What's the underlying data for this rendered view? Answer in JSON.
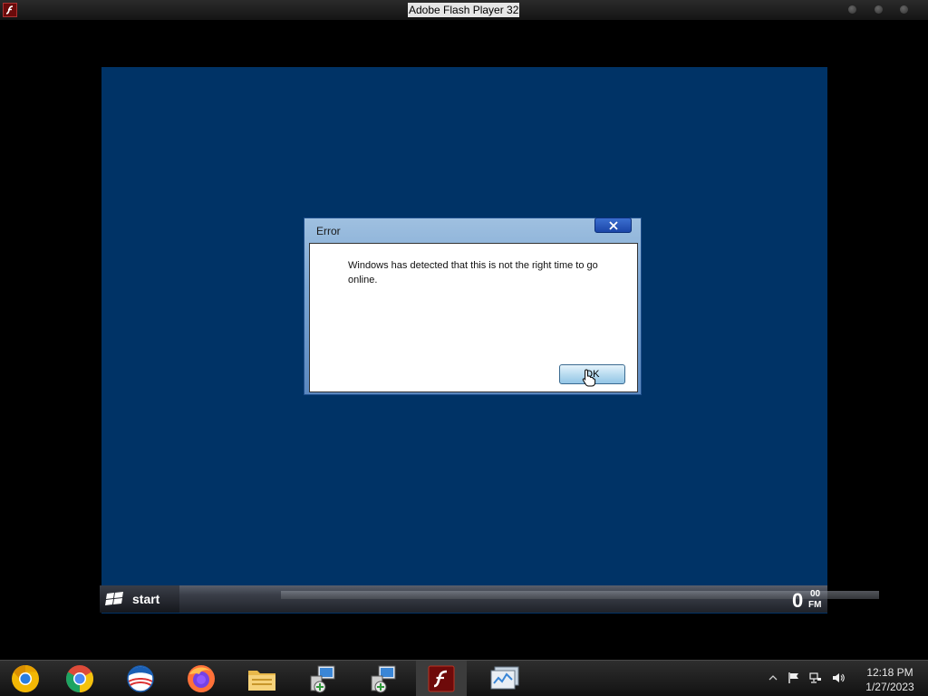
{
  "window": {
    "title": "Adobe Flash Player 32",
    "app_icon": "flash-icon"
  },
  "dialog": {
    "title": "Error",
    "message": "Windows has detected that this is not the right time to go online.",
    "ok_label": "OK",
    "close_icon": "close-icon"
  },
  "sim_taskbar": {
    "start_label": "start",
    "clock_hour": "0",
    "clock_minute": "00",
    "clock_ampm": "FM"
  },
  "taskbar": {
    "pinned": [
      {
        "name": "chrome-canary-icon"
      },
      {
        "name": "chrome-icon"
      },
      {
        "name": "obama-logo-icon"
      },
      {
        "name": "firefox-icon"
      },
      {
        "name": "file-explorer-icon"
      },
      {
        "name": "network-setup-icon"
      },
      {
        "name": "network-setup-icon"
      },
      {
        "name": "flash-player-icon"
      },
      {
        "name": "system-monitor-icon"
      }
    ],
    "time": "12:18 PM",
    "date": "1/27/2023"
  },
  "colors": {
    "stage": "#003366",
    "dialog_frame": "#7aa5d2",
    "ok_button": "#b9dcf0"
  }
}
